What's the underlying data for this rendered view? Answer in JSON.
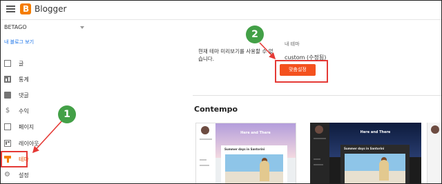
{
  "topbar": {
    "brand": "Blogger",
    "logo_letter": "B"
  },
  "sidebar": {
    "blog_name": "BETAGO",
    "view_blog": "내 블로그 보기",
    "items": [
      {
        "label": "글",
        "icon": "posts-icon",
        "active": false
      },
      {
        "label": "통계",
        "icon": "stats-icon",
        "active": false
      },
      {
        "label": "댓글",
        "icon": "comments-icon",
        "active": false
      },
      {
        "label": "수익",
        "icon": "dollar-icon",
        "active": false
      },
      {
        "label": "페이지",
        "icon": "pages-icon",
        "active": false
      },
      {
        "label": "레이아웃",
        "icon": "layout-icon",
        "active": false
      },
      {
        "label": "테마",
        "icon": "theme-icon",
        "active": true
      },
      {
        "label": "설정",
        "icon": "gear-icon",
        "active": false
      }
    ]
  },
  "main": {
    "preview_text": "현재 테마 미리보기를 사용할 수 없습니다.",
    "my_theme_label": "내 테마",
    "my_theme_name": "custom (수정됨)",
    "customize_button": "맞춤설정",
    "section_title": "Contempo",
    "thumbs": {
      "hero_title": "Here and There",
      "card_title": "Summer days in Santorini"
    }
  },
  "annotations": {
    "step1": "1",
    "step2": "2"
  },
  "colors": {
    "accent": "#f4511e",
    "highlight": "#e53935",
    "badge": "#43a047"
  }
}
